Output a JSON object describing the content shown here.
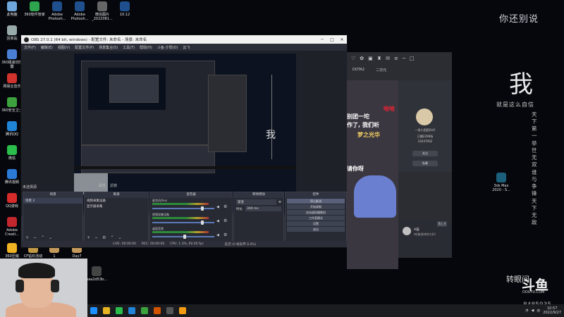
{
  "desktop_icons": [
    {
      "label": "此电脑",
      "color": "#6fa8dc"
    },
    {
      "label": "360软件管家",
      "color": "#2ea44f"
    },
    {
      "label": "Adobe Photosh...",
      "color": "#1f4f8c"
    },
    {
      "label": "Adobe Photosh...",
      "color": "#1f4f8c"
    },
    {
      "label": "微信图片_2022081...",
      "color": "#666"
    },
    {
      "label": "10.12",
      "color": "#1f4f8c"
    },
    {
      "label": "回收站",
      "color": "#9aa"
    },
    {
      "label": "360极速浏览器",
      "color": "#4a7fd6"
    },
    {
      "label": "网易云音乐",
      "color": "#d0332d"
    },
    {
      "label": "360安全卫士",
      "color": "#3da23d"
    },
    {
      "label": "腾讯QQ",
      "color": "#1f83d6"
    },
    {
      "label": "微信",
      "color": "#2bbd4b"
    },
    {
      "label": "腾讯视频",
      "color": "#2b7bd6"
    },
    {
      "label": "QQ游戏",
      "color": "#d62b2b"
    },
    {
      "label": "Adobe Creati...",
      "color": "#c1272d"
    },
    {
      "label": "360压缩",
      "color": "#f0b323"
    },
    {
      "label": "CF钻石活动",
      "color": "#c29a45"
    },
    {
      "label": "1",
      "color": "#c49a5c"
    },
    {
      "label": "Day7",
      "color": "#c49a5c"
    },
    {
      "label": "baa2d53b...",
      "color": "#444"
    },
    {
      "label": "3ds Max 2020 - S...",
      "color": "#1b5f7a"
    }
  ],
  "wallpaper": {
    "title": "你还别说",
    "big_char": "我",
    "line": "就是这么自信",
    "columns": [
      "天下第一",
      "举世无双",
      "谁与争锋",
      "天下无敌"
    ]
  },
  "obs": {
    "title": "OBS 27.0.1 (64 bit, windows) - 配置文件: 未命名 - 场景: 未命名",
    "menu": [
      "文件(F)",
      "编辑(E)",
      "视图(V)",
      "配置文件(P)",
      "场景集合(S)",
      "工具(T)",
      "帮助(H)",
      "斗鱼-夕阳(D)",
      "云飞"
    ],
    "scene_label": "未选择源",
    "scene_tools": [
      "属性",
      "滤镜"
    ],
    "docks": {
      "scenes": {
        "title": "场景",
        "items": [
          "场景 2"
        ]
      },
      "sources": {
        "title": "来源",
        "items": [
          "视频采集设备",
          "显示器采集"
        ]
      },
      "mixer": {
        "title": "混音器",
        "channels": [
          {
            "name": "麦克风/Aux",
            "level": 0.78
          },
          {
            "name": "视频采集设备",
            "level": 0.78
          },
          {
            "name": "桌面音频",
            "level": 0.5
          }
        ]
      },
      "transitions": {
        "title": "转场特效",
        "type": "渐变",
        "duration_label": "时长",
        "duration": "300 ms"
      },
      "controls": {
        "title": "控件",
        "buttons": [
          "停止推流",
          "开始录制",
          "启动虚拟摄像机",
          "工作室模式",
          "设置",
          "退出"
        ]
      }
    },
    "status": [
      "LIVE: 00:00:00",
      "REC: 00:00:00",
      "CPU: 1.3%, 60.00 fps"
    ],
    "status_right": "延迟 (0 帧丢弃 0.0%)"
  },
  "douyu": {
    "tabs": [
      "DOTA2",
      "二次元"
    ],
    "danmaku": [
      "哈哈",
      "别团一坨",
      "作了, 我们听",
      "梦之光华",
      "请你呀"
    ],
    "anchor_name": "一条小团团OvO",
    "stats": [
      "已播2208场",
      "24247002"
    ],
    "follow_btn": "关注",
    "chat_btn": "私聊",
    "guest_name": "A猫",
    "guest_desc": "(听着很帅的大好)",
    "top_btn": "顶上方"
  },
  "watermark": {
    "logo": "斗鱼",
    "url": "DOUYU.COM",
    "room": "8485935",
    "turn_text": "转眼间"
  },
  "taskbar": {
    "time": "10:57",
    "date": "2022/9/27",
    "lang": "中"
  }
}
